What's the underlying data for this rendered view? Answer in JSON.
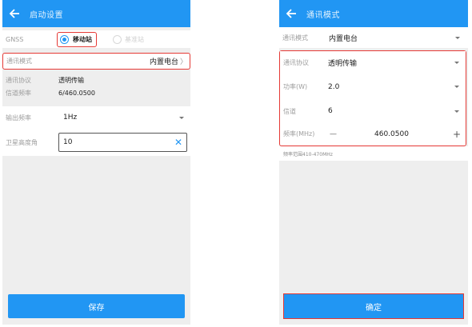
{
  "left": {
    "title": "启动设置",
    "gnss": {
      "label": "GNSS",
      "opt_rover": "移动站",
      "opt_base": "基准站"
    },
    "comm_mode": {
      "label": "通讯模式",
      "value": "内置电台",
      "chevron": "〉"
    },
    "protocol": {
      "label": "通讯协议",
      "value": "透明传输"
    },
    "channel_freq": {
      "label": "信道频率",
      "value": "6/460.0500"
    },
    "output_freq": {
      "label": "输出频率",
      "value": "1Hz"
    },
    "elevation": {
      "label": "卫星高度角",
      "value": "10",
      "clear": "✕"
    },
    "save": "保存"
  },
  "right": {
    "title": "通讯模式",
    "comm_mode": {
      "label": "通讯模式",
      "value": "内置电台"
    },
    "protocol": {
      "label": "通讯协议",
      "value": "透明传输"
    },
    "power": {
      "label": "功率(W)",
      "value": "2.0"
    },
    "channel": {
      "label": "信道",
      "value": "6"
    },
    "frequency": {
      "label": "频率(MHz)",
      "minus": "—",
      "value": "460.0500",
      "plus": "+"
    },
    "hint": "频率范围410-470MHz",
    "confirm": "确定"
  },
  "colors": {
    "primary": "#2196f3",
    "highlight": "#e53935",
    "background": "#eeeeee"
  },
  "icons": {
    "back": "arrow-left-icon",
    "dropdown": "caret-down-icon",
    "clear": "clear-x-icon",
    "chevron": "chevron-right-icon"
  }
}
